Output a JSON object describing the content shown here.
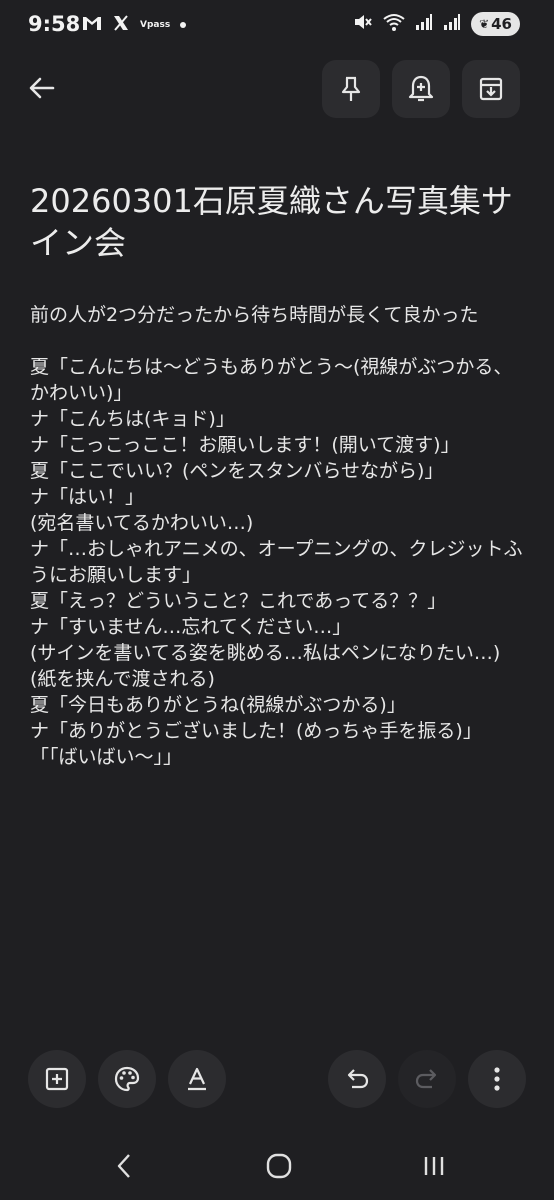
{
  "status_bar": {
    "time": "9:58",
    "left_icons": [
      "gmail-icon",
      "x-icon",
      "vpass-icon",
      "notification-dot"
    ],
    "vpass_label": "Vpass",
    "right_icons": [
      "mute-icon",
      "wifi-icon",
      "signal-icon",
      "signal-icon",
      "battery-icon"
    ],
    "battery": "46"
  },
  "header": {
    "back_icon": "back-arrow-icon",
    "actions": [
      "pin-icon",
      "reminder-bell-icon",
      "archive-icon"
    ]
  },
  "note": {
    "title": "20260301石原夏織さん写真集サイン会",
    "body_lines": [
      "前の人が2つ分だったから待ち時間が長くて良かった",
      "",
      "夏「こんにちは〜どうもありがとう〜(視線がぶつかる、かわいい)」",
      "ナ「こんちは(キョド)」",
      "ナ「こっこっここ！お願いします！(開いて渡す)」",
      "夏「ここでいい？(ペンをスタンバらせながら)」",
      "ナ「はい！」",
      "(宛名書いてるかわいい…)",
      "ナ「…おしゃれアニメの、オープニングの、クレジットふうにお願いします」",
      "夏「えっ？どういうこと？これであってる？？」",
      "ナ「すいません…忘れてください…」",
      "(サインを書いてる姿を眺める…私はペンになりたい…)",
      "(紙を挟んで渡される)",
      "夏「今日もありがとうね(視線がぶつかる)」",
      "ナ「ありがとうございました！(めっちゃ手を振る)」",
      "「「ばいばい〜」」"
    ]
  },
  "toolbar": {
    "left": [
      "add-box-icon",
      "palette-icon",
      "text-format-icon"
    ],
    "right": [
      "undo-icon",
      "redo-icon",
      "more-vert-icon"
    ]
  },
  "nav": [
    "back-nav-icon",
    "home-nav-icon",
    "recents-nav-icon"
  ],
  "colors": {
    "background": "#1f1f22",
    "button": "#2c2c2f",
    "text": "#e6e6e6"
  }
}
